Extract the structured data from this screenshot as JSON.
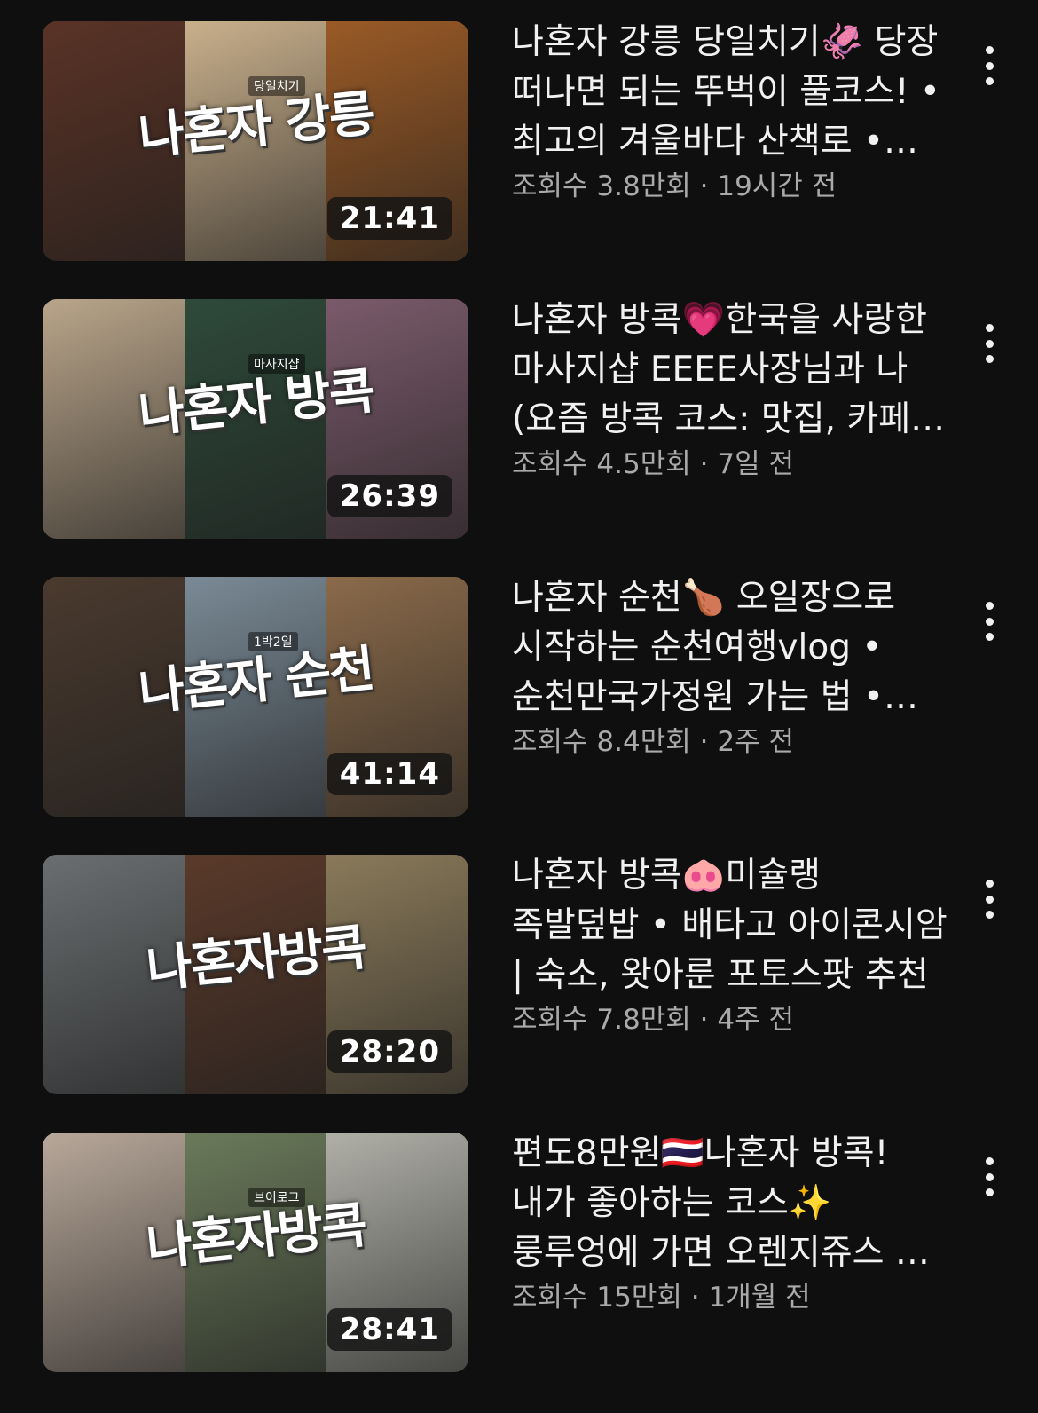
{
  "videos": [
    {
      "thumb_text": "나혼자 강릉",
      "thumb_subtext": "당일치기",
      "duration": "21:41",
      "title": "나혼자 강릉 당일치기🦑 당장 떠나면 되는 뚜벅이 풀코스! • 최고의 겨울바다 산책로 • 강릉 맛집 카페",
      "views": "조회수 3.8만회",
      "age": "19시간 전",
      "panel_colors": [
        "#5a3326",
        "#c9b08c",
        "#9a5a26"
      ]
    },
    {
      "thumb_text": "나혼자 방콕",
      "thumb_subtext": "마사지샵",
      "duration": "26:39",
      "title": "나혼자 방콕💗한국을 사랑한 마사지샵 EEEE사장님과 나 (요즘 방콕 코스: 맛집, 카페, 쇼핑)",
      "views": "조회수 4.5만회",
      "age": "7일 전",
      "panel_colors": [
        "#b9a58a",
        "#2e4a3a",
        "#7a5a6a"
      ]
    },
    {
      "thumb_text": "나혼자 순천",
      "thumb_subtext": "1박2일",
      "duration": "41:14",
      "title": "나혼자 순천🍗 오일장으로 시작하는 순천여행vlog • 순천만국가정원 가는 법 • 순천 맛집",
      "views": "조회수 8.4만회",
      "age": "2주 전",
      "panel_colors": [
        "#4a3a2e",
        "#7a8a96",
        "#8a6a4a"
      ]
    },
    {
      "thumb_text": "나혼자방콕",
      "thumb_subtext": "",
      "duration": "28:20",
      "title": "나혼자 방콕🐽미슐랭 족발덮밥 • 배타고 아이콘시암 | 숙소, 왓아룬 포토스팟 추천",
      "views": "조회수 7.8만회",
      "age": "4주 전",
      "panel_colors": [
        "#6a6e70",
        "#5a3a2a",
        "#8a7a5a"
      ]
    },
    {
      "thumb_text": "나혼자방콕",
      "thumb_subtext": "브이로그",
      "duration": "28:41",
      "title": "편도8만원🇹🇭나혼자 방콕! 내가 좋아하는 코스✨룽루엉에 가면 오렌지쥬스 꼭 마시기",
      "views": "조회수 15만회",
      "age": "1개월 전",
      "panel_colors": [
        "#b8a89a",
        "#6a7a5a",
        "#b0b0a8"
      ]
    }
  ]
}
